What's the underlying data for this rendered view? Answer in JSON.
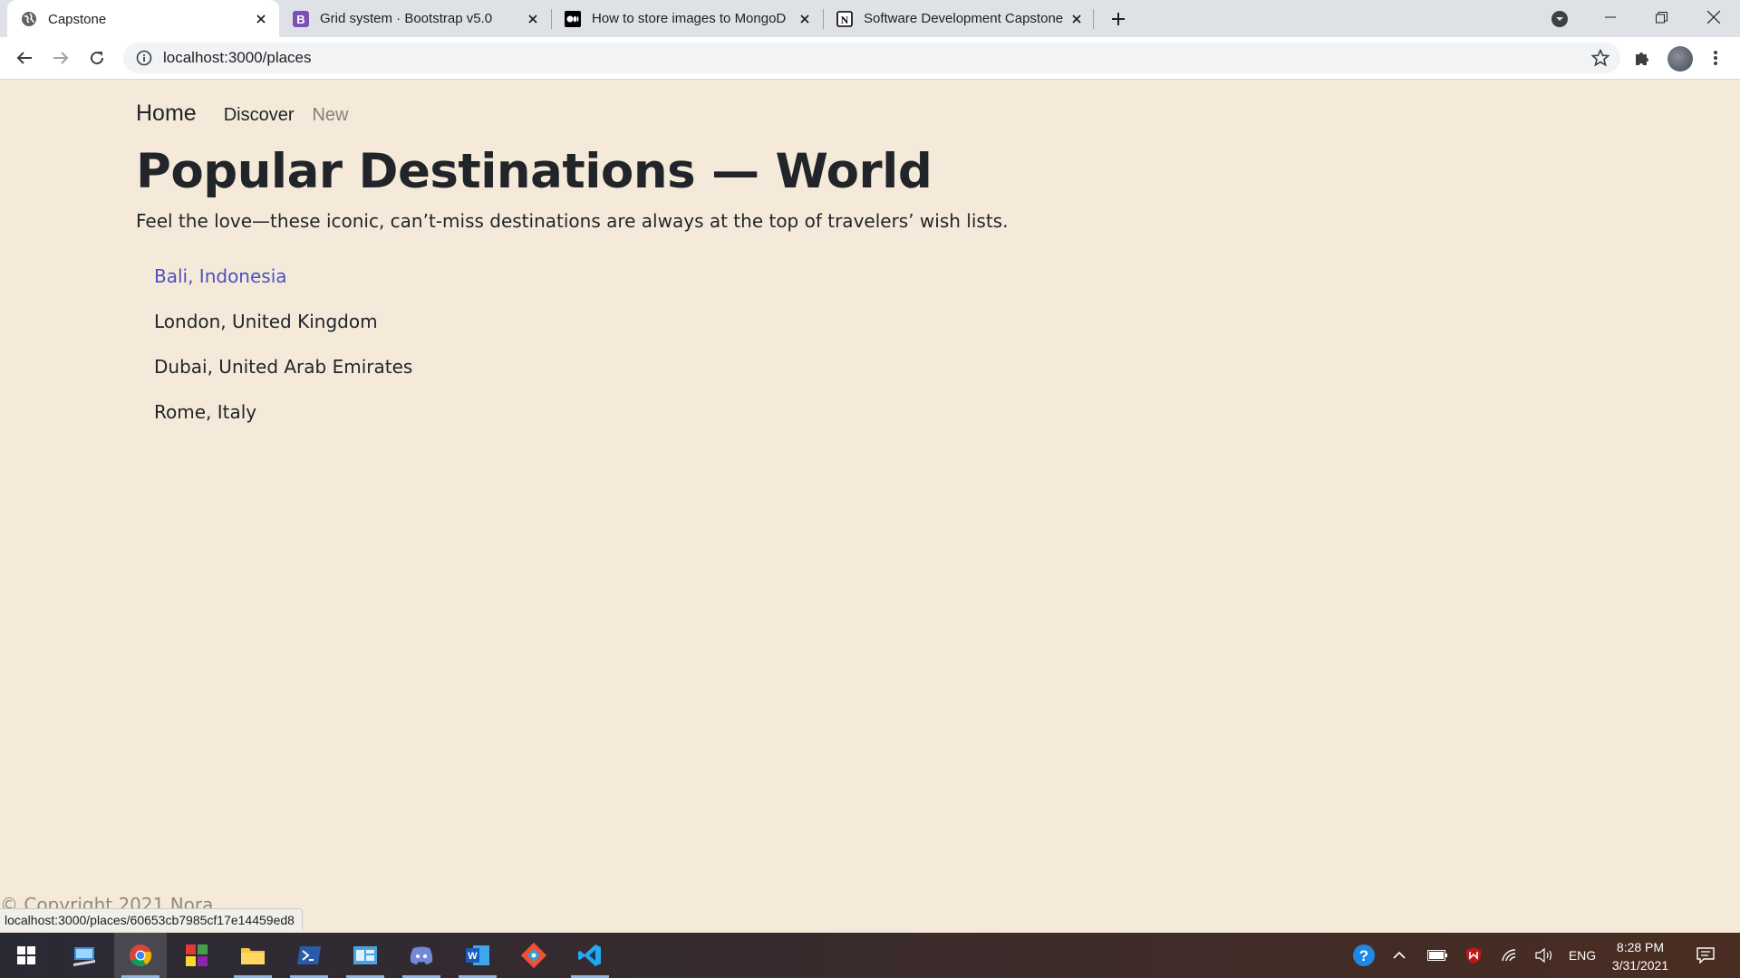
{
  "browser": {
    "tabs": [
      {
        "title": "Capstone",
        "icon": "globe-icon",
        "active": true
      },
      {
        "title": "Grid system · Bootstrap v5.0",
        "icon": "bootstrap-icon",
        "active": false
      },
      {
        "title": "How to store images to MongoD",
        "icon": "medium-icon",
        "active": false
      },
      {
        "title": "Software Development Capstone",
        "icon": "notion-icon",
        "active": false
      }
    ],
    "url": "localhost:3000/places"
  },
  "nav": {
    "brand": "Home",
    "links": [
      "Discover",
      "New"
    ]
  },
  "page": {
    "title": "Popular Destinations — World",
    "lead": "Feel the love—these iconic, can’t-miss destinations are always at the top of travelers’ wish lists.",
    "places": [
      "Bali, Indonesia",
      "London, United Kingdom",
      "Dubai, United Arab Emirates",
      "Rome, Italy"
    ],
    "footer": "© Copyright 2021 Nora"
  },
  "status_url": "localhost:3000/places/60653cb7985cf17e14459ed8",
  "taskbar": {
    "apps": [
      "start-icon",
      "remote-desktop-icon",
      "chrome-icon",
      "app-icon",
      "file-explorer-icon",
      "powershell-icon",
      "control-panel-icon",
      "discord-icon",
      "word-icon",
      "git-icon",
      "vscode-icon"
    ],
    "language": "ENG",
    "time": "8:28 PM",
    "date": "3/31/2021"
  },
  "colors": {
    "page_background": "#f5ead9",
    "link": "#4a52c0",
    "text": "#212529"
  }
}
